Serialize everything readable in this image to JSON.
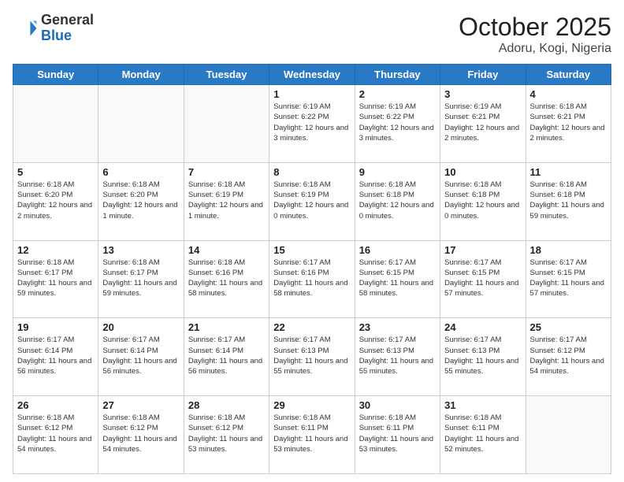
{
  "header": {
    "logo_general": "General",
    "logo_blue": "Blue",
    "month": "October 2025",
    "location": "Adoru, Kogi, Nigeria"
  },
  "days_of_week": [
    "Sunday",
    "Monday",
    "Tuesday",
    "Wednesday",
    "Thursday",
    "Friday",
    "Saturday"
  ],
  "weeks": [
    [
      {
        "day": "",
        "info": ""
      },
      {
        "day": "",
        "info": ""
      },
      {
        "day": "",
        "info": ""
      },
      {
        "day": "1",
        "info": "Sunrise: 6:19 AM\nSunset: 6:22 PM\nDaylight: 12 hours and 3 minutes."
      },
      {
        "day": "2",
        "info": "Sunrise: 6:19 AM\nSunset: 6:22 PM\nDaylight: 12 hours and 3 minutes."
      },
      {
        "day": "3",
        "info": "Sunrise: 6:19 AM\nSunset: 6:21 PM\nDaylight: 12 hours and 2 minutes."
      },
      {
        "day": "4",
        "info": "Sunrise: 6:18 AM\nSunset: 6:21 PM\nDaylight: 12 hours and 2 minutes."
      }
    ],
    [
      {
        "day": "5",
        "info": "Sunrise: 6:18 AM\nSunset: 6:20 PM\nDaylight: 12 hours and 2 minutes."
      },
      {
        "day": "6",
        "info": "Sunrise: 6:18 AM\nSunset: 6:20 PM\nDaylight: 12 hours and 1 minute."
      },
      {
        "day": "7",
        "info": "Sunrise: 6:18 AM\nSunset: 6:19 PM\nDaylight: 12 hours and 1 minute."
      },
      {
        "day": "8",
        "info": "Sunrise: 6:18 AM\nSunset: 6:19 PM\nDaylight: 12 hours and 0 minutes."
      },
      {
        "day": "9",
        "info": "Sunrise: 6:18 AM\nSunset: 6:18 PM\nDaylight: 12 hours and 0 minutes."
      },
      {
        "day": "10",
        "info": "Sunrise: 6:18 AM\nSunset: 6:18 PM\nDaylight: 12 hours and 0 minutes."
      },
      {
        "day": "11",
        "info": "Sunrise: 6:18 AM\nSunset: 6:18 PM\nDaylight: 11 hours and 59 minutes."
      }
    ],
    [
      {
        "day": "12",
        "info": "Sunrise: 6:18 AM\nSunset: 6:17 PM\nDaylight: 11 hours and 59 minutes."
      },
      {
        "day": "13",
        "info": "Sunrise: 6:18 AM\nSunset: 6:17 PM\nDaylight: 11 hours and 59 minutes."
      },
      {
        "day": "14",
        "info": "Sunrise: 6:18 AM\nSunset: 6:16 PM\nDaylight: 11 hours and 58 minutes."
      },
      {
        "day": "15",
        "info": "Sunrise: 6:17 AM\nSunset: 6:16 PM\nDaylight: 11 hours and 58 minutes."
      },
      {
        "day": "16",
        "info": "Sunrise: 6:17 AM\nSunset: 6:15 PM\nDaylight: 11 hours and 58 minutes."
      },
      {
        "day": "17",
        "info": "Sunrise: 6:17 AM\nSunset: 6:15 PM\nDaylight: 11 hours and 57 minutes."
      },
      {
        "day": "18",
        "info": "Sunrise: 6:17 AM\nSunset: 6:15 PM\nDaylight: 11 hours and 57 minutes."
      }
    ],
    [
      {
        "day": "19",
        "info": "Sunrise: 6:17 AM\nSunset: 6:14 PM\nDaylight: 11 hours and 56 minutes."
      },
      {
        "day": "20",
        "info": "Sunrise: 6:17 AM\nSunset: 6:14 PM\nDaylight: 11 hours and 56 minutes."
      },
      {
        "day": "21",
        "info": "Sunrise: 6:17 AM\nSunset: 6:14 PM\nDaylight: 11 hours and 56 minutes."
      },
      {
        "day": "22",
        "info": "Sunrise: 6:17 AM\nSunset: 6:13 PM\nDaylight: 11 hours and 55 minutes."
      },
      {
        "day": "23",
        "info": "Sunrise: 6:17 AM\nSunset: 6:13 PM\nDaylight: 11 hours and 55 minutes."
      },
      {
        "day": "24",
        "info": "Sunrise: 6:17 AM\nSunset: 6:13 PM\nDaylight: 11 hours and 55 minutes."
      },
      {
        "day": "25",
        "info": "Sunrise: 6:17 AM\nSunset: 6:12 PM\nDaylight: 11 hours and 54 minutes."
      }
    ],
    [
      {
        "day": "26",
        "info": "Sunrise: 6:18 AM\nSunset: 6:12 PM\nDaylight: 11 hours and 54 minutes."
      },
      {
        "day": "27",
        "info": "Sunrise: 6:18 AM\nSunset: 6:12 PM\nDaylight: 11 hours and 54 minutes."
      },
      {
        "day": "28",
        "info": "Sunrise: 6:18 AM\nSunset: 6:12 PM\nDaylight: 11 hours and 53 minutes."
      },
      {
        "day": "29",
        "info": "Sunrise: 6:18 AM\nSunset: 6:11 PM\nDaylight: 11 hours and 53 minutes."
      },
      {
        "day": "30",
        "info": "Sunrise: 6:18 AM\nSunset: 6:11 PM\nDaylight: 11 hours and 53 minutes."
      },
      {
        "day": "31",
        "info": "Sunrise: 6:18 AM\nSunset: 6:11 PM\nDaylight: 11 hours and 52 minutes."
      },
      {
        "day": "",
        "info": ""
      }
    ]
  ]
}
